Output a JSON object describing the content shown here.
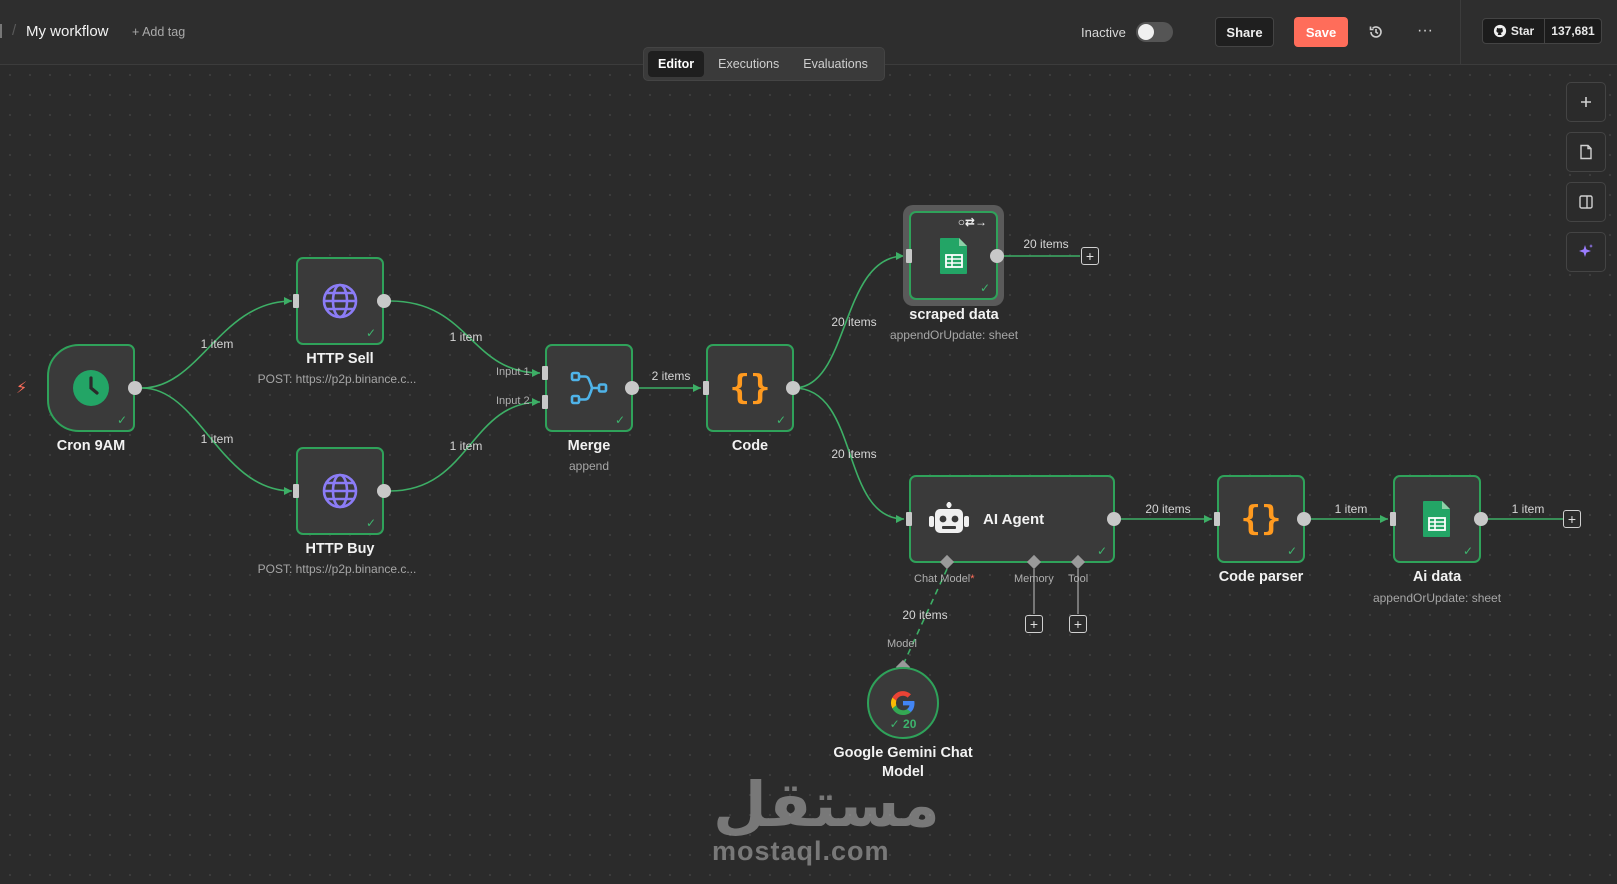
{
  "topbar": {
    "workflow_title": "My workflow",
    "add_tag": "+ Add tag",
    "status_label": "Inactive",
    "share_label": "Share",
    "save_label": "Save",
    "more_label": "···",
    "github_star_label": "Star",
    "github_star_count": "137,681"
  },
  "tabs": {
    "editor": "Editor",
    "executions": "Executions",
    "evaluations": "Evaluations",
    "active": "Editor"
  },
  "side_tools": [
    "zoom-in",
    "sticky-note",
    "toggle-panel",
    "ai-assistant"
  ],
  "nodes": {
    "cron": {
      "label": "Cron 9AM"
    },
    "http_sell": {
      "label": "HTTP Sell",
      "subtitle": "POST: https://p2p.binance.c..."
    },
    "http_buy": {
      "label": "HTTP Buy",
      "subtitle": "POST: https://p2p.binance.c..."
    },
    "merge": {
      "label": "Merge",
      "subtitle": "append",
      "input1": "Input 1",
      "input2": "Input 2"
    },
    "code": {
      "label": "Code"
    },
    "scraped_data": {
      "label": "scraped data",
      "subtitle": "appendOrUpdate: sheet"
    },
    "ai_agent": {
      "label": "AI Agent",
      "port_chat_model": "Chat Model",
      "port_required": "*",
      "port_memory": "Memory",
      "port_tool": "Tool"
    },
    "code_parser": {
      "label": "Code parser"
    },
    "ai_data": {
      "label": "Ai data",
      "subtitle": "appendOrUpdate: sheet"
    },
    "gemini": {
      "label_line1": "Google Gemini Chat",
      "label_line2": "Model",
      "badge": "20",
      "port_model": "Model"
    }
  },
  "edges": {
    "cron_to_sell": "1 item",
    "cron_to_buy": "1 item",
    "sell_to_merge": "1 item",
    "buy_to_merge": "1 item",
    "merge_to_code": "2 items",
    "code_to_scraped": "20 items",
    "scraped_out": "20 items",
    "code_to_agent": "20 items",
    "agent_to_parser": "20 items",
    "parser_to_aidata": "1 item",
    "aidata_out": "1 item",
    "gemini_to_agent": "20 items"
  },
  "watermark": {
    "arabic": "مستقل",
    "latin": "mostaql.com"
  },
  "colors": {
    "success": "#2fa25a",
    "save": "#ff6d5a",
    "code": "#ff9a1f",
    "http": "#8b7cf6",
    "sheets": "#23a566",
    "cron": "#23a566",
    "merge": "#4fb3e8"
  }
}
